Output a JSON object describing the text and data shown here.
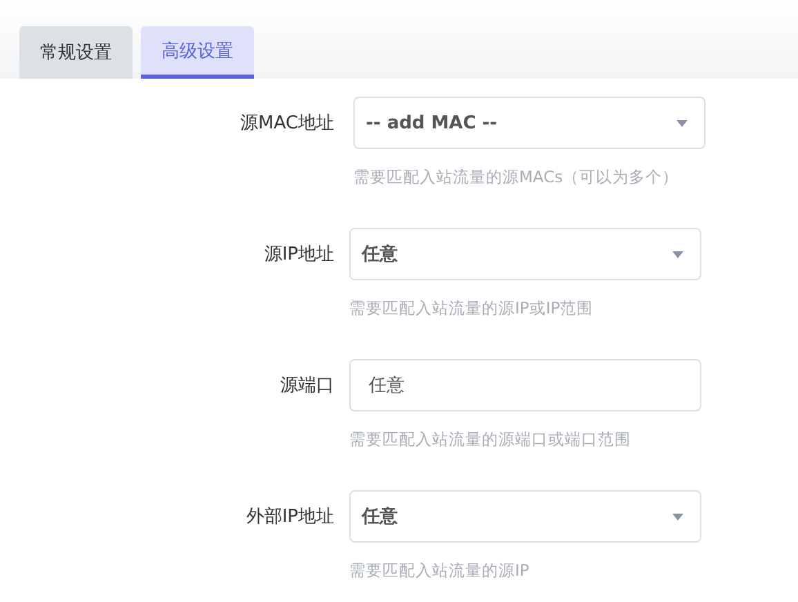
{
  "tabs": [
    {
      "label": "常规设置",
      "selected": false
    },
    {
      "label": "高级设置",
      "selected": true
    }
  ],
  "fields": [
    {
      "label": "源MAC地址",
      "kind": "select",
      "value": "-- add MAC --",
      "hint": "需要匹配入站流量的源MACs（可以为多个）"
    },
    {
      "label": "源IP地址",
      "kind": "select",
      "value": "任意",
      "hint": "需要匹配入站流量的源IP或IP范围"
    },
    {
      "label": "源端口",
      "kind": "input",
      "value": "任意",
      "hint": "需要匹配入站流量的源端口或端口范围"
    },
    {
      "label": "外部IP地址",
      "kind": "select",
      "value": "任意",
      "hint": "需要匹配入站流量的源IP"
    }
  ]
}
